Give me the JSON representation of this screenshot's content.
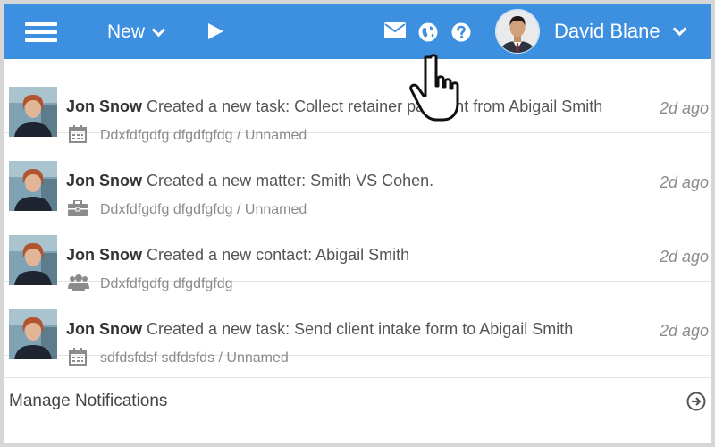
{
  "header": {
    "new_label": "New",
    "user_name": "David Blane"
  },
  "notifications": [
    {
      "actor": "Jon Snow",
      "message": "Created a new task: Collect retainer payment from Abigail Smith",
      "meta": "Ddxfdfgdfg dfgdfgfdg / Unnamed",
      "icon": "calendar-icon",
      "time": "2d ago"
    },
    {
      "actor": "Jon Snow",
      "message": "Created a new matter: Smith VS Cohen.",
      "meta": "Ddxfdfgdfg dfgdfgfdg / Unnamed",
      "icon": "briefcase-icon",
      "time": "2d ago"
    },
    {
      "actor": "Jon Snow",
      "message": "Created a new contact: Abigail Smith",
      "meta": "Ddxfdfgdfg dfgdfgfdg",
      "icon": "contacts-icon",
      "time": "2d ago"
    },
    {
      "actor": "Jon Snow",
      "message": "Created a new task: Send client intake form to Abigail Smith",
      "meta": "sdfdsfdsf sdfdsfds / Unnamed",
      "icon": "calendar-icon",
      "time": "2d ago"
    }
  ],
  "footer": {
    "manage_label": "Manage Notifications"
  },
  "colors": {
    "header_bg": "#3d8fe0",
    "text_muted": "#8b8b8b"
  }
}
